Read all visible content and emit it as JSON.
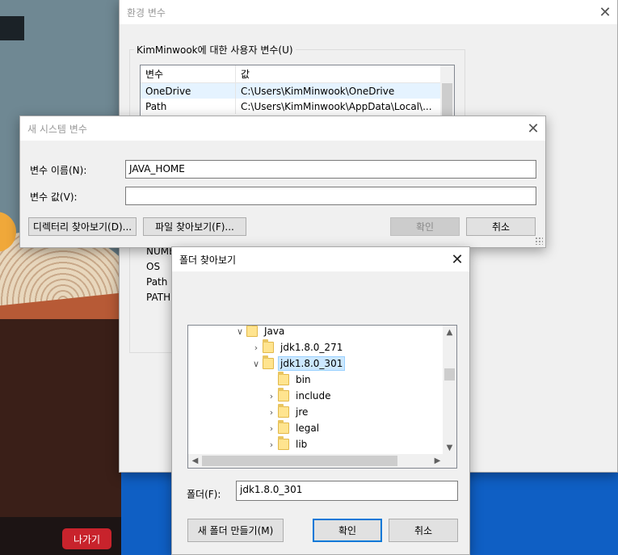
{
  "background": {
    "exit_button_label": "나가기"
  },
  "env_window": {
    "title": "환경 변수",
    "user_group_title": "KimMinwook에 대한 사용자 변수(U)",
    "columns": [
      "변수",
      "값"
    ],
    "rows": [
      {
        "name": "OneDrive",
        "value": "C:\\Users\\KimMinwook\\OneDrive"
      },
      {
        "name": "Path",
        "value": "C:\\Users\\KimMinwook\\AppData\\Local\\..."
      }
    ],
    "system_rows_visible": [
      "NUMB",
      "OS",
      "Path",
      "PATHE"
    ]
  },
  "new_var_dialog": {
    "title": "새 시스템 변수",
    "name_label": "변수 이름(N):",
    "name_value": "JAVA_HOME",
    "value_label": "변수 값(V):",
    "value_value": "",
    "browse_dir_label": "디렉터리 찾아보기(D)...",
    "browse_file_label": "파일 찾아보기(F)...",
    "ok_label": "확인",
    "cancel_label": "취소"
  },
  "browse_dialog": {
    "title": "폴더 찾아보기",
    "tree": [
      {
        "label": "Java",
        "chevron": "down"
      },
      {
        "label": "jdk1.8.0_271",
        "chevron": "right"
      },
      {
        "label": "jdk1.8.0_301",
        "chevron": "down",
        "selected": true
      },
      {
        "label": "bin",
        "chevron": ""
      },
      {
        "label": "include",
        "chevron": "right"
      },
      {
        "label": "jre",
        "chevron": "right"
      },
      {
        "label": "legal",
        "chevron": "right"
      },
      {
        "label": "lib",
        "chevron": "right"
      }
    ],
    "folder_label": "폴더(F):",
    "folder_value": "jdk1.8.0_301",
    "new_folder_label": "새 폴더 만들기(M)",
    "ok_label": "확인",
    "cancel_label": "취소"
  }
}
